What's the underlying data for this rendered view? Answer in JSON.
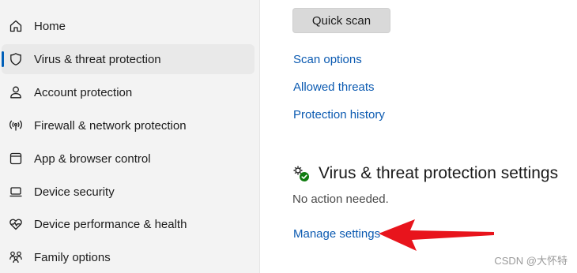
{
  "sidebar": {
    "items": [
      {
        "label": "Home",
        "icon": "home-icon"
      },
      {
        "label": "Virus & threat protection",
        "icon": "shield-icon",
        "selected": true
      },
      {
        "label": "Account protection",
        "icon": "person-icon"
      },
      {
        "label": "Firewall & network protection",
        "icon": "wifi-broadcast-icon"
      },
      {
        "label": "App & browser control",
        "icon": "app-window-icon"
      },
      {
        "label": "Device security",
        "icon": "laptop-icon"
      },
      {
        "label": "Device performance & health",
        "icon": "heart-pulse-icon"
      },
      {
        "label": "Family options",
        "icon": "family-icon"
      }
    ]
  },
  "main": {
    "quick_scan_label": "Quick scan",
    "links": [
      "Scan options",
      "Allowed threats",
      "Protection history"
    ],
    "settings_section": {
      "icon": "gear-check-icon",
      "title": "Virus & threat protection settings",
      "status": "No action needed.",
      "manage_link": "Manage settings"
    }
  },
  "annotation": {
    "arrow_color": "#e8141c"
  },
  "watermark": "CSDN @大怀特",
  "colors": {
    "accent": "#005fb8",
    "link": "#0b5ab1",
    "sidebar_bg": "#f3f3f3"
  }
}
